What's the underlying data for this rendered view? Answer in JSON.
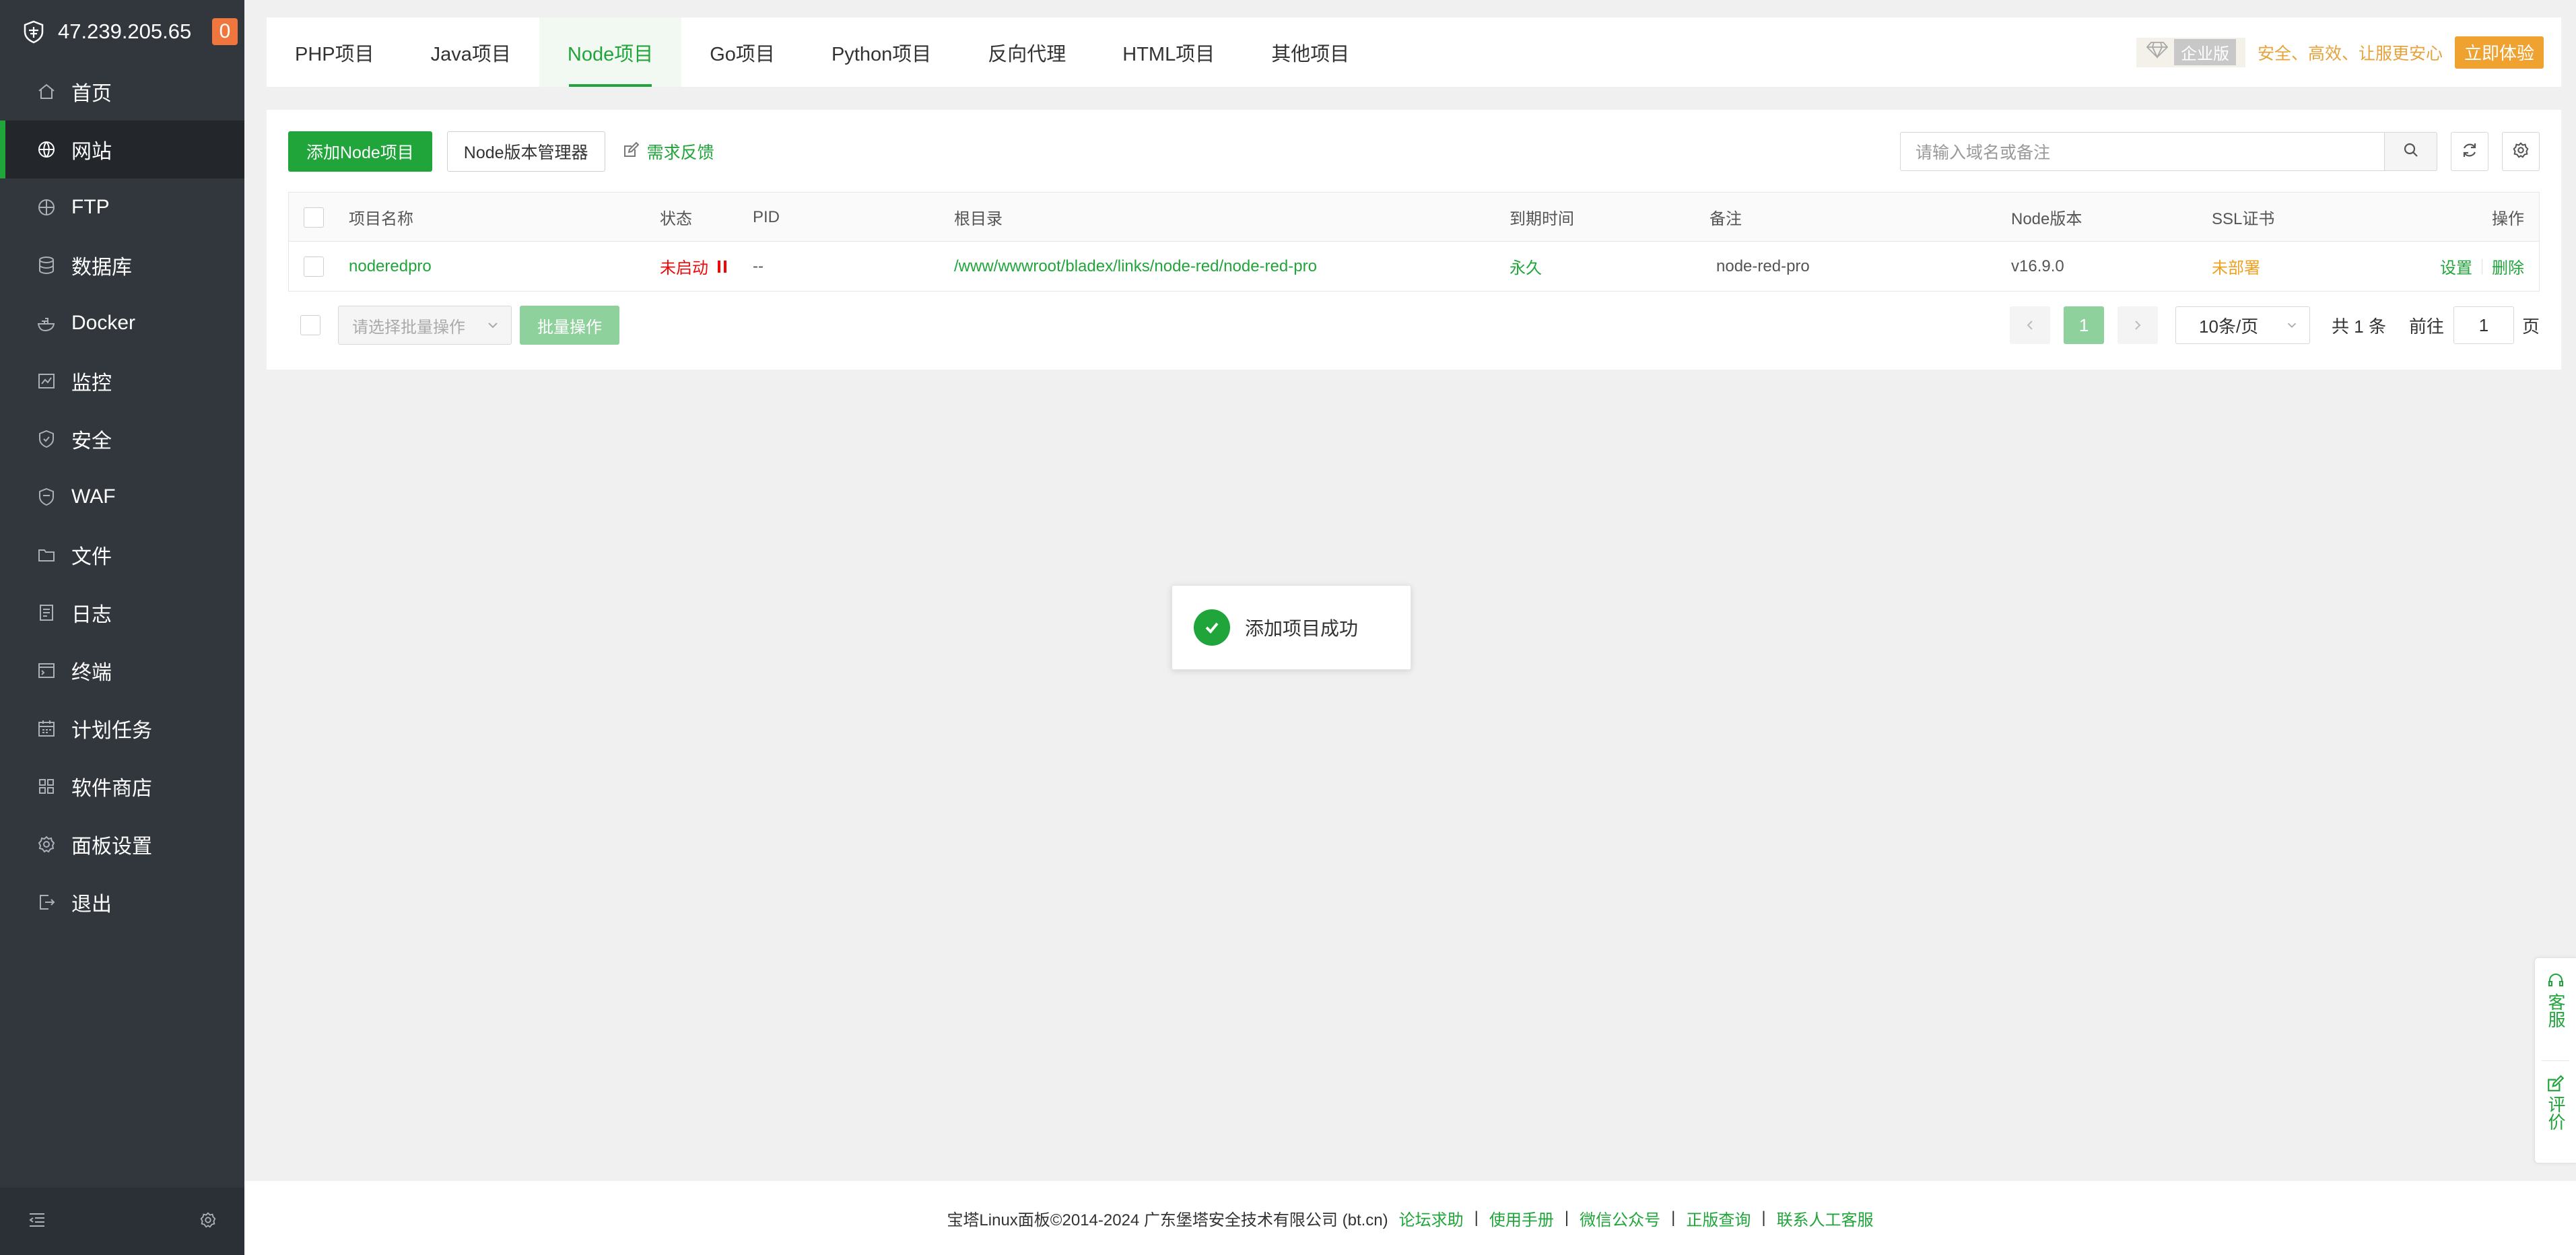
{
  "sidebar": {
    "server_ip": "47.239.205.65",
    "badge_count": "0",
    "items": [
      {
        "label": "首页",
        "icon": "home-icon"
      },
      {
        "label": "网站",
        "icon": "globe-icon",
        "active": true
      },
      {
        "label": "FTP",
        "icon": "ftp-icon"
      },
      {
        "label": "数据库",
        "icon": "database-icon"
      },
      {
        "label": "Docker",
        "icon": "docker-icon"
      },
      {
        "label": "监控",
        "icon": "monitor-icon"
      },
      {
        "label": "安全",
        "icon": "shield-icon"
      },
      {
        "label": "WAF",
        "icon": "waf-shield-icon"
      },
      {
        "label": "文件",
        "icon": "folder-icon"
      },
      {
        "label": "日志",
        "icon": "log-icon"
      },
      {
        "label": "终端",
        "icon": "terminal-icon"
      },
      {
        "label": "计划任务",
        "icon": "calendar-icon"
      },
      {
        "label": "软件商店",
        "icon": "apps-grid-icon"
      },
      {
        "label": "面板设置",
        "icon": "settings-icon"
      },
      {
        "label": "退出",
        "icon": "logout-icon"
      }
    ]
  },
  "tabs": [
    {
      "label": "PHP项目"
    },
    {
      "label": "Java项目"
    },
    {
      "label": "Node项目",
      "active": true
    },
    {
      "label": "Go项目"
    },
    {
      "label": "Python项目"
    },
    {
      "label": "反向代理"
    },
    {
      "label": "HTML项目"
    },
    {
      "label": "其他项目"
    }
  ],
  "promo": {
    "edition": "企业版",
    "slogan": "安全、高效、让服更安心",
    "button": "立即体验"
  },
  "toolbar": {
    "add_button": "添加Node项目",
    "version_manager": "Node版本管理器",
    "feedback": "需求反馈",
    "search_placeholder": "请输入域名或备注"
  },
  "table": {
    "headers": {
      "name": "项目名称",
      "status": "状态",
      "pid": "PID",
      "root": "根目录",
      "expire": "到期时间",
      "remark": "备注",
      "node_version": "Node版本",
      "ssl": "SSL证书",
      "ops": "操作"
    },
    "rows": [
      {
        "name": "noderedpro",
        "status": "未启动",
        "pid": "--",
        "root": "/www/wwwroot/bladex/links/node-red/node-red-pro",
        "expire": "永久",
        "remark": "node-red-pro",
        "node_version": "v16.9.0",
        "ssl": "未部署",
        "op_settings": "设置",
        "op_delete": "删除"
      }
    ]
  },
  "batch": {
    "select_placeholder": "请选择批量操作",
    "button": "批量操作"
  },
  "pagination": {
    "current_page": "1",
    "page_size": "10条/页",
    "total": "共 1 条",
    "goto_label": "前往",
    "goto_value": "1",
    "unit": "页"
  },
  "toast": {
    "message": "添加项目成功"
  },
  "float_service": {
    "support": "客服",
    "review": "评价"
  },
  "footer": {
    "copyright": "宝塔Linux面板©2014-2024 广东堡塔安全技术有限公司 (bt.cn)",
    "links": [
      "论坛求助",
      "使用手册",
      "微信公众号",
      "正版查询",
      "联系人工客服"
    ]
  },
  "colors": {
    "accent": "#20a53a",
    "sidebar_bg": "#32373e",
    "danger": "#ef0808",
    "warning": "#f0a020"
  }
}
